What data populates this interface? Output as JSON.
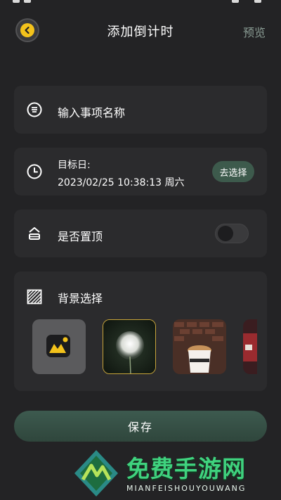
{
  "header": {
    "title": "添加倒计时",
    "preview_label": "预览",
    "back_icon": "chevron-left-icon"
  },
  "event_name": {
    "placeholder": "输入事项名称",
    "icon": "list-circle-icon"
  },
  "target_date": {
    "label": "目标日:",
    "value": "2023/02/25 10:38:13 周六",
    "button_label": "去选择",
    "icon": "clock-icon"
  },
  "pin_top": {
    "label": "是否置顶",
    "enabled": false,
    "icon": "pin-top-icon"
  },
  "background": {
    "label": "背景选择",
    "icon": "hatch-square-icon",
    "options": [
      {
        "name": "custom-image",
        "selected": false
      },
      {
        "name": "dandelion",
        "selected": true
      },
      {
        "name": "coffee-cup",
        "selected": false
      },
      {
        "name": "red-car",
        "selected": false
      }
    ]
  },
  "save_label": "保存",
  "watermark": {
    "title": "免费手游网",
    "subtitle": "MIANFEISHOUYOUWANG"
  },
  "colors": {
    "accent": "#f3c21b",
    "button": "#3d5a4c",
    "background": "#232325",
    "card": "#2b2b2d",
    "watermark": "#3fd27e"
  }
}
